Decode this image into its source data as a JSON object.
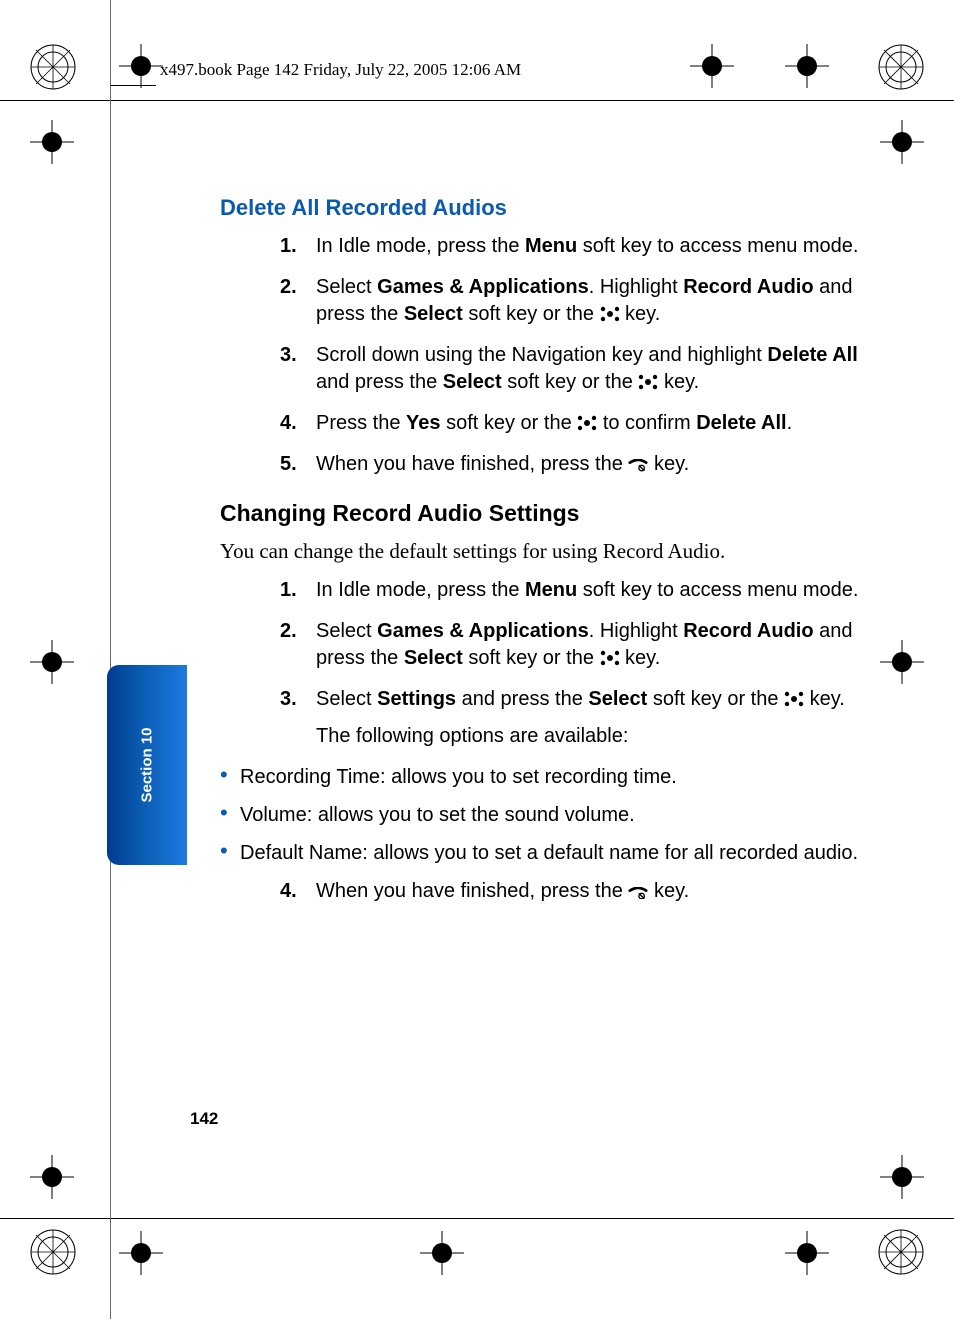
{
  "header": {
    "text": "x497.book  Page 142  Friday, July 22, 2005  12:06 AM"
  },
  "section_tab": "Section 10",
  "page_number": "142",
  "h1": "Delete All Recorded Audios",
  "steps_a": {
    "n1": "1.",
    "s1a": "In Idle mode, press the ",
    "s1b": "Menu",
    "s1c": " soft key to access menu mode.",
    "n2": "2.",
    "s2a": "Select ",
    "s2b": "Games & Applications",
    "s2c": ". Highlight ",
    "s2d": "Record Audio",
    "s2e": " and press the ",
    "s2f": "Select",
    "s2g": " soft key or the ",
    "s2h": " key.",
    "n3": "3.",
    "s3a": "Scroll down using the Navigation key and highlight ",
    "s3b": "Delete All",
    "s3c": " and press the ",
    "s3d": "Select",
    "s3e": " soft key or the ",
    "s3f": " key.",
    "n4": "4.",
    "s4a": "Press the ",
    "s4b": "Yes",
    "s4c": " soft key or the ",
    "s4d": " to confirm ",
    "s4e": "Delete All",
    "s4f": ".",
    "n5": "5.",
    "s5a": "When you have finished, press the ",
    "s5b": " key."
  },
  "h2": "Changing Record Audio Settings",
  "intro": "You can change the default settings for using Record Audio.",
  "steps_b": {
    "n1": "1.",
    "s1a": " In Idle mode, press the ",
    "s1b": "Menu",
    "s1c": " soft key to access menu mode.",
    "n2": "2.",
    "s2a": "Select ",
    "s2b": "Games & Applications",
    "s2c": ". Highlight ",
    "s2d": "Record Audio",
    "s2e": " and press the ",
    "s2f": "Select",
    "s2g": " soft key or the ",
    "s2h": " key.",
    "n3": "3.",
    "s3a": "Select ",
    "s3b": "Settings",
    "s3c": " and press the ",
    "s3d": "Select",
    "s3e": " soft key or the ",
    "s3f": " key.",
    "s3note": "The following options are available:",
    "n4": "4.",
    "s4a": "When you have finished, press the ",
    "s4b": " key."
  },
  "bullets": {
    "b1": "Recording Time: allows you to set recording time.",
    "b2": "Volume: allows you to set the sound volume.",
    "b3": "Default Name: allows you to set a default name for all recorded audio."
  }
}
